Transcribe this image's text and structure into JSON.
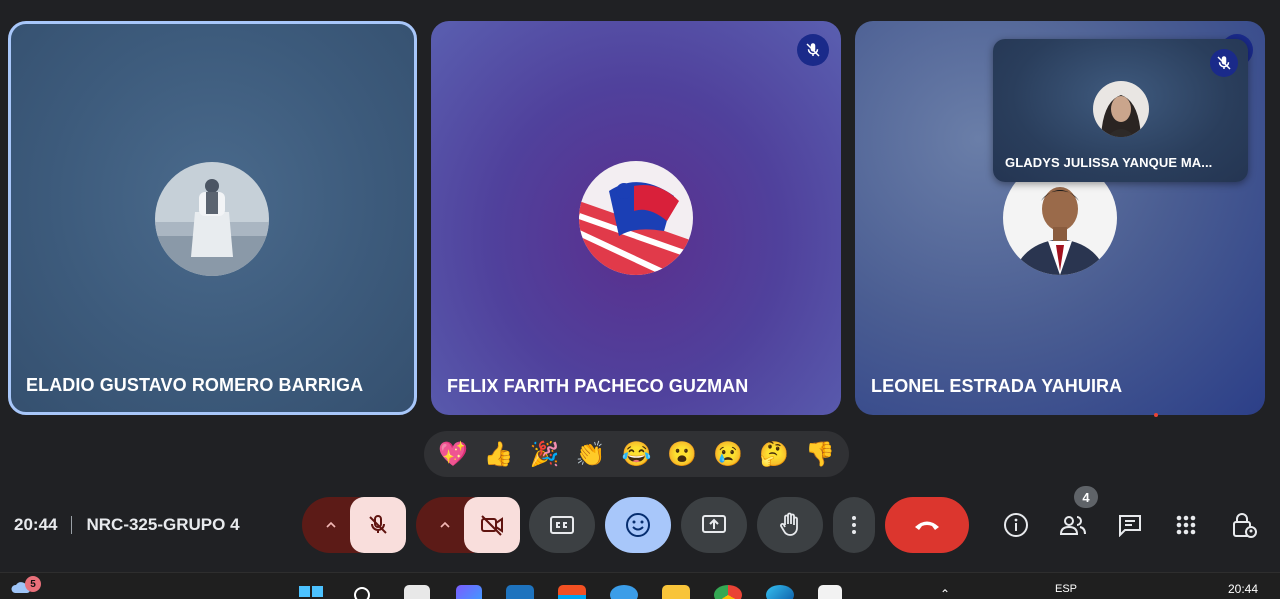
{
  "participants": [
    {
      "name": "ELADIO GUSTAVO ROMERO BARRIGA",
      "muted": false
    },
    {
      "name": "FELIX FARITH PACHECO GUZMAN",
      "muted": true
    },
    {
      "name": "LEONEL ESTRADA YAHUIRA",
      "muted": true
    }
  ],
  "pinned_self": {
    "name": "GLADYS JULISSA YANQUE MA...",
    "muted": true
  },
  "reactions": [
    "💖",
    "👍",
    "🎉",
    "👏",
    "😂",
    "😮",
    "😢",
    "🤔",
    "👎"
  ],
  "meeting": {
    "time": "20:44",
    "code": "NRC-325-GRUPO 4"
  },
  "people_count": "4",
  "taskbar": {
    "weather_badge": "5",
    "language": "ESP",
    "time": "20:44"
  },
  "colors": {
    "end_call": "#dc362e",
    "reactions_active": "#a8c7fa",
    "mic_off_bg": "#f9dedc"
  }
}
